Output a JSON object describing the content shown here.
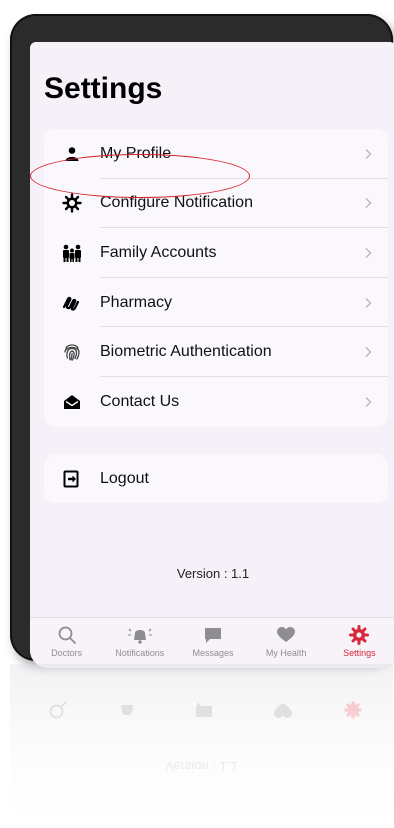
{
  "page": {
    "title": "Settings",
    "version_text": "Version : 1.1"
  },
  "menu": {
    "items": [
      {
        "label": "My Profile",
        "icon": "person-icon"
      },
      {
        "label": "Configure Notification",
        "icon": "gear-icon"
      },
      {
        "label": "Family Accounts",
        "icon": "family-icon"
      },
      {
        "label": "Pharmacy",
        "icon": "prescription-icon"
      },
      {
        "label": "Biometric Authentication",
        "icon": "fingerprint-icon"
      },
      {
        "label": "Contact Us",
        "icon": "envelope-open-icon"
      }
    ]
  },
  "logout": {
    "label": "Logout",
    "icon": "logout-icon"
  },
  "tabbar": {
    "tabs": [
      {
        "label": "Doctors",
        "icon": "search-icon",
        "active": false
      },
      {
        "label": "Notifications",
        "icon": "bell-icon",
        "active": false
      },
      {
        "label": "Messages",
        "icon": "chat-bubble-icon",
        "active": false
      },
      {
        "label": "My Health",
        "icon": "heart-icon",
        "active": false
      },
      {
        "label": "Settings",
        "icon": "gear-icon",
        "active": true
      }
    ]
  },
  "colors": {
    "accent": "#d9263b",
    "annotation": "#d8222a",
    "screen_bg": "#f6f0f9"
  }
}
